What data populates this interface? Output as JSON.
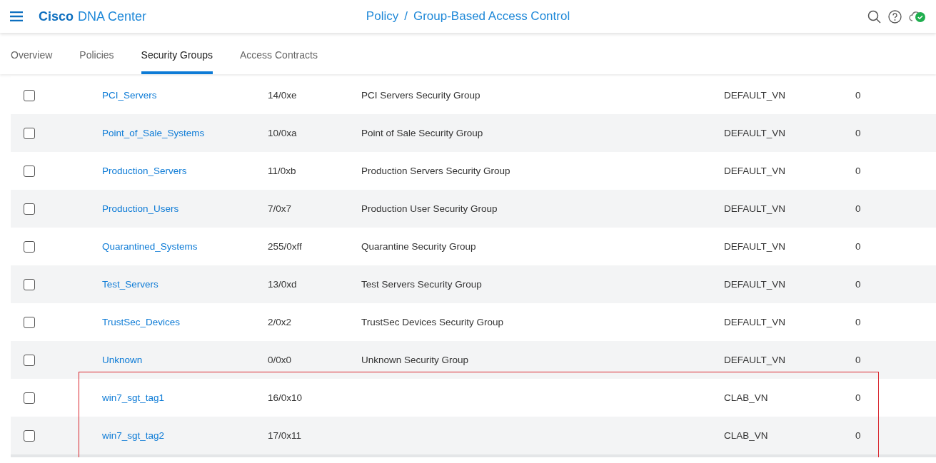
{
  "header": {
    "brand": "Cisco",
    "product": "DNA Center",
    "breadcrumb": [
      "Policy",
      "Group-Based Access Control"
    ],
    "separator": "/"
  },
  "tabs": [
    {
      "label": "Overview",
      "selected": false
    },
    {
      "label": "Policies",
      "selected": false
    },
    {
      "label": "Security Groups",
      "selected": true
    },
    {
      "label": "Access Contracts",
      "selected": false
    }
  ],
  "rows": [
    {
      "name": "PCI_Servers",
      "tag": "14/0xe",
      "description": "PCI Servers Security Group",
      "virtual_network": "DEFAULT_VN",
      "count": "0",
      "checked": false,
      "highlighted": false
    },
    {
      "name": "Point_of_Sale_Systems",
      "tag": "10/0xa",
      "description": "Point of Sale Security Group",
      "virtual_network": "DEFAULT_VN",
      "count": "0",
      "checked": false,
      "highlighted": false
    },
    {
      "name": "Production_Servers",
      "tag": "11/0xb",
      "description": "Production Servers Security Group",
      "virtual_network": "DEFAULT_VN",
      "count": "0",
      "checked": false,
      "highlighted": false
    },
    {
      "name": "Production_Users",
      "tag": "7/0x7",
      "description": "Production User Security Group",
      "virtual_network": "DEFAULT_VN",
      "count": "0",
      "checked": false,
      "highlighted": false
    },
    {
      "name": "Quarantined_Systems",
      "tag": "255/0xff",
      "description": "Quarantine Security Group",
      "virtual_network": "DEFAULT_VN",
      "count": "0",
      "checked": false,
      "highlighted": false
    },
    {
      "name": "Test_Servers",
      "tag": "13/0xd",
      "description": "Test Servers Security Group",
      "virtual_network": "DEFAULT_VN",
      "count": "0",
      "checked": false,
      "highlighted": false
    },
    {
      "name": "TrustSec_Devices",
      "tag": "2/0x2",
      "description": "TrustSec Devices Security Group",
      "virtual_network": "DEFAULT_VN",
      "count": "0",
      "checked": false,
      "highlighted": false
    },
    {
      "name": "Unknown",
      "tag": "0/0x0",
      "description": "Unknown Security Group",
      "virtual_network": "DEFAULT_VN",
      "count": "0",
      "checked": false,
      "highlighted": false
    },
    {
      "name": "win7_sgt_tag1",
      "tag": "16/0x10",
      "virtual_network": "CLAB_VN",
      "count": "0",
      "checked": false,
      "highlighted": true
    },
    {
      "name": "win7_sgt_tag2",
      "tag": "17/0x11",
      "virtual_network": "CLAB_VN",
      "count": "0",
      "checked": false,
      "highlighted": true
    }
  ]
}
